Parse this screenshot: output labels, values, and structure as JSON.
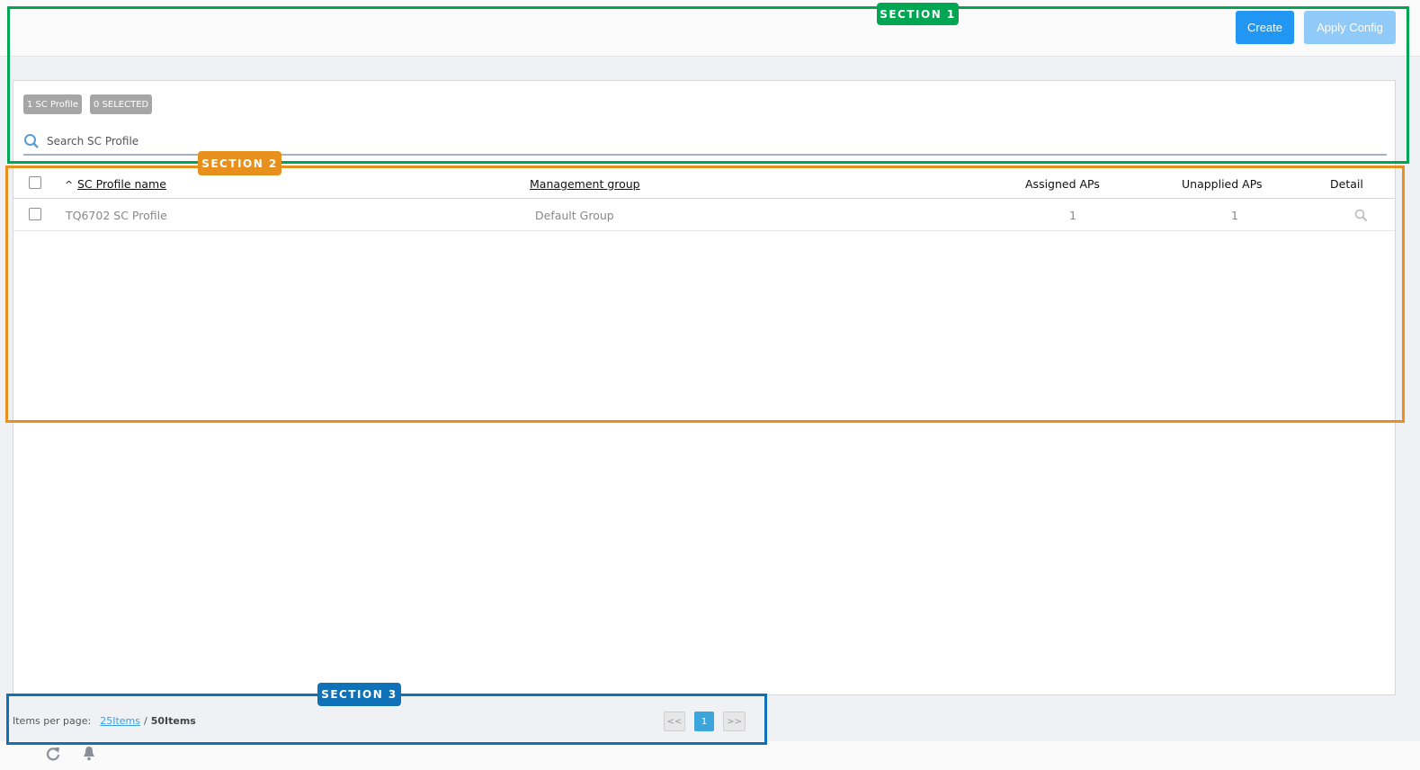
{
  "header": {
    "create_label": "Create",
    "apply_label": "Apply Config"
  },
  "badges": {
    "count": "1 SC Profile",
    "selected": "0 SELECTED"
  },
  "search": {
    "placeholder": "Search SC Profile"
  },
  "table": {
    "columns": [
      "SC Profile name",
      "Management group",
      "Assigned APs",
      "Unapplied APs",
      "Detail"
    ],
    "rows": [
      {
        "name": "TQ6702 SC Profile",
        "group": "Default Group",
        "assigned": "1",
        "unapplied": "1"
      }
    ]
  },
  "footer": {
    "items_per_page_label": "Items per page:",
    "option_25": "25Items",
    "separator": "/",
    "option_50": "50Items",
    "prev": "<<",
    "page": "1",
    "next": ">>"
  },
  "overlays": {
    "s1": "SECTION 1",
    "s2": "SECTION 2",
    "s3": "SECTION 3"
  },
  "colors": {
    "primary": "#2196f3",
    "s1": "#00a651",
    "s2": "#e8901e",
    "s3": "#0f72b9"
  }
}
